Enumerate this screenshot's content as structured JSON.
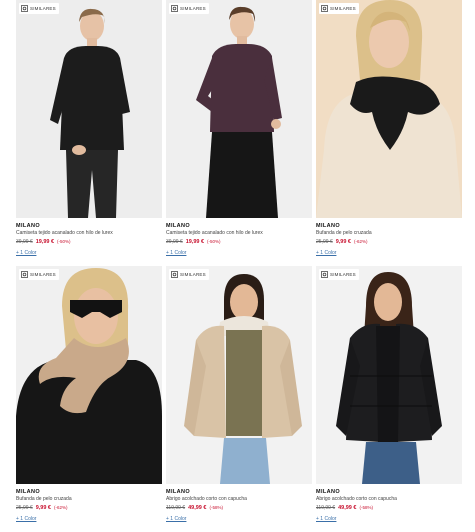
{
  "similar_label": "SIMILARES",
  "products": [
    {
      "brand": "MILANO",
      "name": "Camiseta tejido acanalado con hilo de lurex",
      "old_price": "39,99 €",
      "price": "19,99 €",
      "discount": "(-50%)",
      "colors": "+ 1 Color",
      "bg": "#ededed",
      "garment": "#1c1c1c"
    },
    {
      "brand": "MILANO",
      "name": "Camiseta tejido acanalado con hilo de lurex",
      "old_price": "39,99 €",
      "price": "19,99 €",
      "discount": "(-50%)",
      "colors": "+ 1 Color",
      "bg": "#efefef",
      "garment": "#4a2f3d"
    },
    {
      "brand": "MILANO",
      "name": "Bufanda de pelo cruzada",
      "old_price": "25,99 €",
      "price": "9,99 €",
      "discount": "(-62%)",
      "colors": "+ 1 Color",
      "bg": "#f1ddc4",
      "garment": "#1a1a1a"
    },
    {
      "brand": "MILANO",
      "name": "Bufanda de pelo cruzada",
      "old_price": "25,99 €",
      "price": "9,99 €",
      "discount": "(-62%)",
      "colors": "+ 1 Color",
      "bg": "#f0f0f0",
      "garment": "#c9a98a"
    },
    {
      "brand": "MILANO",
      "name": "Abrigo acolchado corto con capucha",
      "old_price": "119,99 €",
      "price": "49,99 €",
      "discount": "(-58%)",
      "colors": "+ 1 Color",
      "bg": "#f2f2f2",
      "garment": "#d9c3a6"
    },
    {
      "brand": "MILANO",
      "name": "Abrigo acolchado corto con capucha",
      "old_price": "119,99 €",
      "price": "49,99 €",
      "discount": "(-58%)",
      "colors": "+ 1 Color",
      "bg": "#f2f2f2",
      "garment": "#1d1d1f"
    }
  ]
}
